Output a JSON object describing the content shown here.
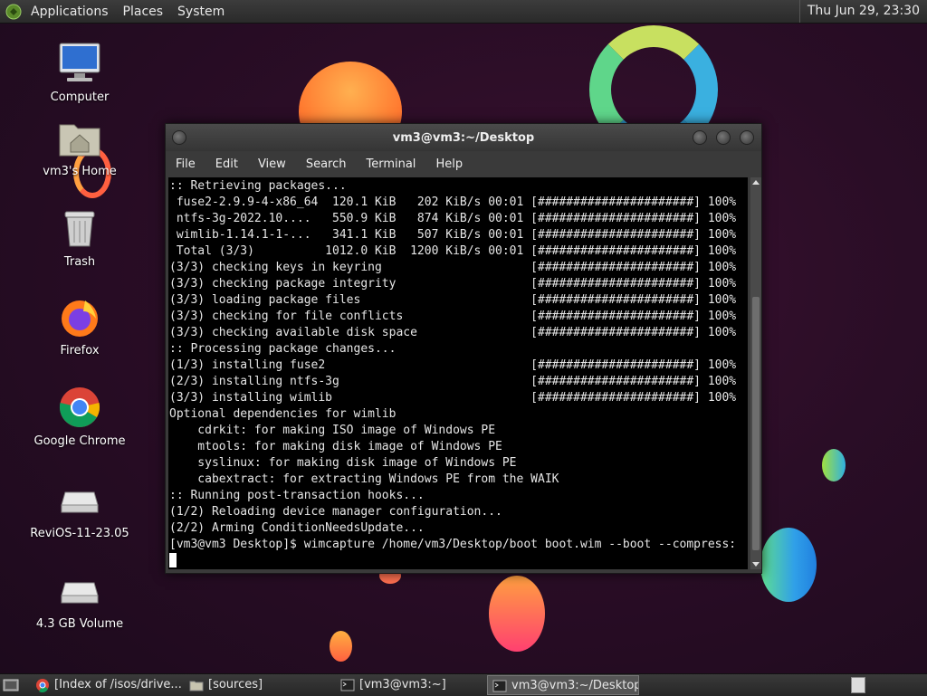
{
  "top_panel": {
    "menus": [
      "Applications",
      "Places",
      "System"
    ],
    "clock": "Thu Jun 29, 23:30"
  },
  "desktop_icons": [
    {
      "label": "Computer",
      "icon": "computer-icon"
    },
    {
      "label": "vm3's Home",
      "icon": "home-folder-icon"
    },
    {
      "label": "Trash",
      "icon": "trash-icon"
    },
    {
      "label": "Firefox",
      "icon": "firefox-icon"
    },
    {
      "label": "Google Chrome",
      "icon": "chrome-icon"
    },
    {
      "label": "ReviOS-11-23.05",
      "icon": "drive-icon"
    },
    {
      "label": "4.3 GB Volume",
      "icon": "drive-icon"
    }
  ],
  "terminal": {
    "title": "vm3@vm3:~/Desktop",
    "menu": [
      "File",
      "Edit",
      "View",
      "Search",
      "Terminal",
      "Help"
    ],
    "lines": [
      ":: Retrieving packages...",
      " fuse2-2.9.9-4-x86_64  120.1 KiB   202 KiB/s 00:01 [######################] 100%",
      " ntfs-3g-2022.10....   550.9 KiB   874 KiB/s 00:01 [######################] 100%",
      " wimlib-1.14.1-1-...   341.1 KiB   507 KiB/s 00:01 [######################] 100%",
      " Total (3/3)          1012.0 KiB  1200 KiB/s 00:01 [######################] 100%",
      "(3/3) checking keys in keyring                     [######################] 100%",
      "(3/3) checking package integrity                   [######################] 100%",
      "(3/3) loading package files                        [######################] 100%",
      "(3/3) checking for file conflicts                  [######################] 100%",
      "(3/3) checking available disk space                [######################] 100%",
      ":: Processing package changes...",
      "(1/3) installing fuse2                             [######################] 100%",
      "(2/3) installing ntfs-3g                           [######################] 100%",
      "(3/3) installing wimlib                            [######################] 100%",
      "Optional dependencies for wimlib",
      "    cdrkit: for making ISO image of Windows PE",
      "    mtools: for making disk image of Windows PE",
      "    syslinux: for making disk image of Windows PE",
      "    cabextract: for extracting Windows PE from the WAIK",
      ":: Running post-transaction hooks...",
      "(1/2) Reloading device manager configuration...",
      "(2/2) Arming ConditionNeedsUpdate...",
      "[vm3@vm3 Desktop]$ wimcapture /home/vm3/Desktop/boot boot.wim --boot --compress:"
    ]
  },
  "taskbar": {
    "tasks": [
      {
        "label": "[Index of /isos/drive...",
        "icon": "chrome-icon"
      },
      {
        "label": "[sources]",
        "icon": "folder-icon"
      },
      {
        "label": "[vm3@vm3:~]",
        "icon": "terminal-icon"
      },
      {
        "label": "vm3@vm3:~/Desktop",
        "icon": "terminal-icon",
        "active": true
      }
    ]
  }
}
